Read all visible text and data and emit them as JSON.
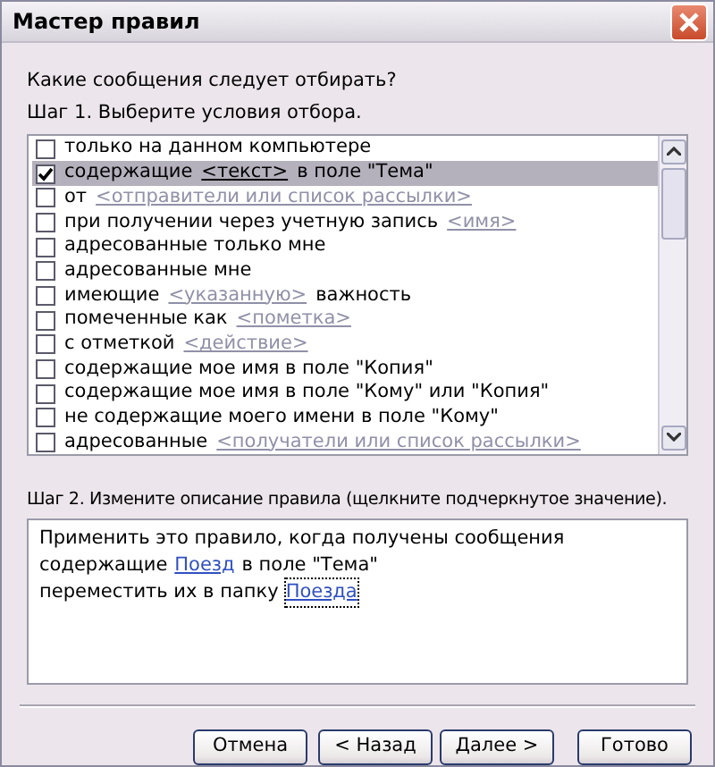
{
  "window": {
    "title": "Мастер правил"
  },
  "question": "Какие сообщения следует отбирать?",
  "step1": {
    "label": "Шаг 1. Выберите условия отбора.",
    "conditions": [
      {
        "text": "только на данном компьютере",
        "checked": false,
        "selected": false
      },
      {
        "text": "содержащие",
        "link": "<текст>",
        "text_after": "в поле \"Тема\"",
        "checked": true,
        "selected": true
      },
      {
        "text": "от",
        "link": "<отправители или список рассылки>",
        "checked": false,
        "selected": false
      },
      {
        "text": "при получении через учетную запись",
        "link": "<имя>",
        "checked": false,
        "selected": false
      },
      {
        "text": "адресованные только мне",
        "checked": false,
        "selected": false
      },
      {
        "text": "адресованные мне",
        "checked": false,
        "selected": false
      },
      {
        "text": "имеющие",
        "link": "<указанную>",
        "text_after": "важность",
        "checked": false,
        "selected": false
      },
      {
        "text": "помеченные как",
        "link": "<пометка>",
        "checked": false,
        "selected": false
      },
      {
        "text": "с отметкой",
        "link": "<действие>",
        "checked": false,
        "selected": false
      },
      {
        "text": "содержащие мое имя в поле \"Копия\"",
        "checked": false,
        "selected": false
      },
      {
        "text": "содержащие мое имя в поле \"Кому\" или \"Копия\"",
        "checked": false,
        "selected": false
      },
      {
        "text": "не содержащие моего имени в поле \"Кому\"",
        "checked": false,
        "selected": false
      },
      {
        "text": "адресованные",
        "link": "<получатели или список рассылки>",
        "checked": false,
        "selected": false
      }
    ]
  },
  "step2": {
    "label": "Шаг 2. Измените описание правила (щелкните подчеркнутое значение).",
    "lines": [
      {
        "text": "Применить это правило, когда получены сообщения"
      },
      {
        "text": "содержащие",
        "link": "Поезд",
        "text_after": "в поле \"Тема\""
      },
      {
        "text": "переместить их в папку",
        "link": "Поезда",
        "focused": true
      }
    ]
  },
  "buttons": [
    "Отмена",
    "< Назад",
    "Далее >",
    "Готово"
  ]
}
